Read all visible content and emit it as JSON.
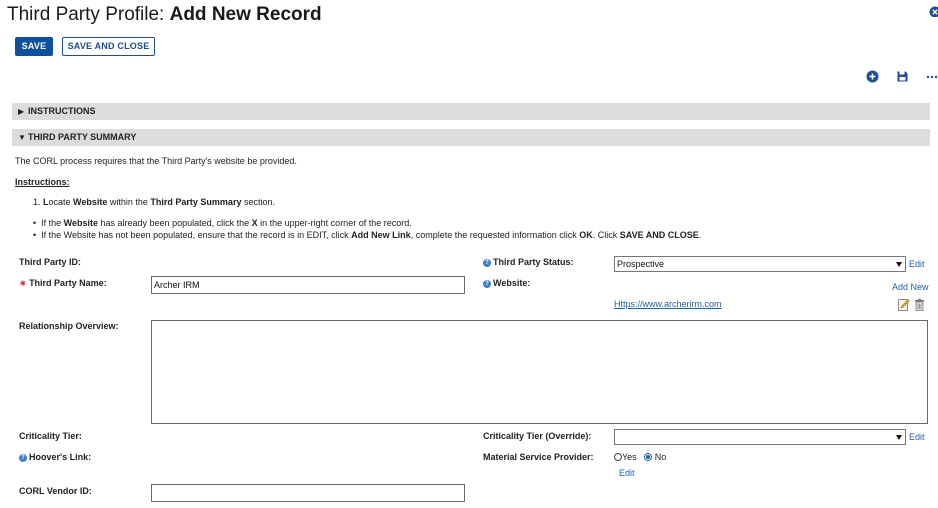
{
  "header": {
    "title_prefix": "Third Party Profile: ",
    "title_bold": "Add New Record"
  },
  "toolbar": {
    "save_label": "SAVE",
    "save_close_label": "SAVE AND CLOSE",
    "icons": [
      "add-circle-icon",
      "save-disk-icon",
      "more-options-icon"
    ]
  },
  "sections": {
    "instructions": {
      "label": "INSTRUCTIONS"
    },
    "summary": {
      "label": "THIRD PARTY SUMMARY"
    }
  },
  "summary": {
    "intro": "The CORL process requires that the Third Party's website be provided.",
    "instructions_heading": "Instructions:",
    "step1": {
      "num": "1. ",
      "a": "L",
      "b": "ocate ",
      "c": "Website",
      "d": " within the ",
      "e": "Third Party Summary",
      "f": " section."
    },
    "bullet1": {
      "a": "If the ",
      "b": "Website",
      "c": " has already been populated, click the ",
      "d": "X",
      "e": " in the upper-right corner of the record."
    },
    "bullet2": {
      "a": "If the Website has not been populated, ensure that the record is in EDIT, click ",
      "b": "Add New Link",
      "c": ", complete the requested information click ",
      "d": "OK",
      "e": ". Click ",
      "f": "SAVE AND CLOSE",
      "g": "."
    }
  },
  "fields": {
    "third_party_id": {
      "label": "Third Party ID:"
    },
    "third_party_name": {
      "label": "Third Party Name:",
      "value": "Archer IRM"
    },
    "relationship_overview": {
      "label": "Relationship Overview:",
      "value": ""
    },
    "criticality_tier": {
      "label": "Criticality Tier:"
    },
    "hoovers_link": {
      "label": "Hoover's Link:"
    },
    "corl_vendor_id": {
      "label": "CORL Vendor ID:",
      "value": ""
    },
    "third_party_status": {
      "label": "Third Party Status:",
      "value": "Prospective",
      "edit": "Edit"
    },
    "website": {
      "label": "Website:",
      "add_new": "Add New",
      "url": "Https://www.archerirm.com"
    },
    "criticality_override": {
      "label": "Criticality Tier (Override):",
      "value": "",
      "edit": "Edit"
    },
    "material_service_provider": {
      "label": "Material Service Provider:",
      "yes": "Yes",
      "no": "No",
      "selected": "No",
      "edit": "Edit"
    }
  },
  "colors": {
    "primary": "#0e4f9e",
    "link": "#1f5fa8",
    "section_bg": "#dcdcdc",
    "required": "#c0282d"
  }
}
